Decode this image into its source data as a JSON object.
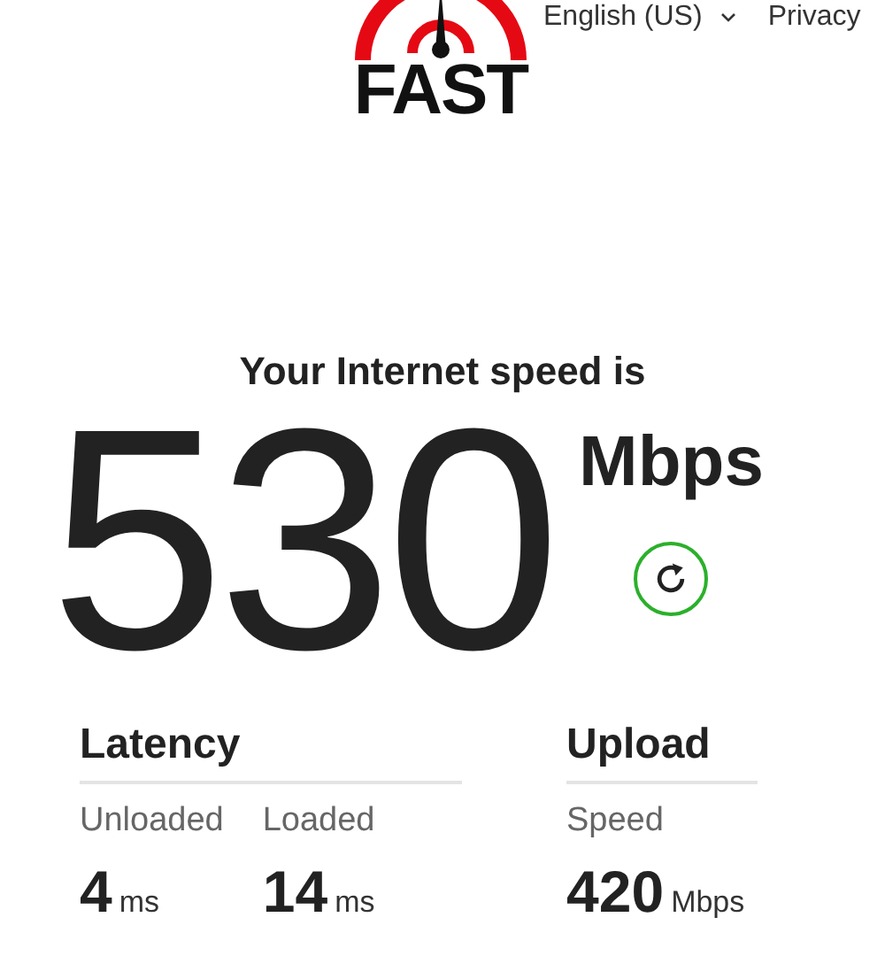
{
  "header": {
    "logo_text": "FAST",
    "language": "English (US)",
    "privacy": "Privacy"
  },
  "result": {
    "heading": "Your Internet speed is",
    "value": "530",
    "unit": "Mbps"
  },
  "metrics": [
    {
      "title": "Latency",
      "items": [
        {
          "label": "Unloaded",
          "value": "4",
          "unit": "ms"
        },
        {
          "label": "Loaded",
          "value": "14",
          "unit": "ms"
        }
      ]
    },
    {
      "title": "Upload",
      "items": [
        {
          "label": "Speed",
          "value": "420",
          "unit": "Mbps"
        }
      ]
    }
  ]
}
